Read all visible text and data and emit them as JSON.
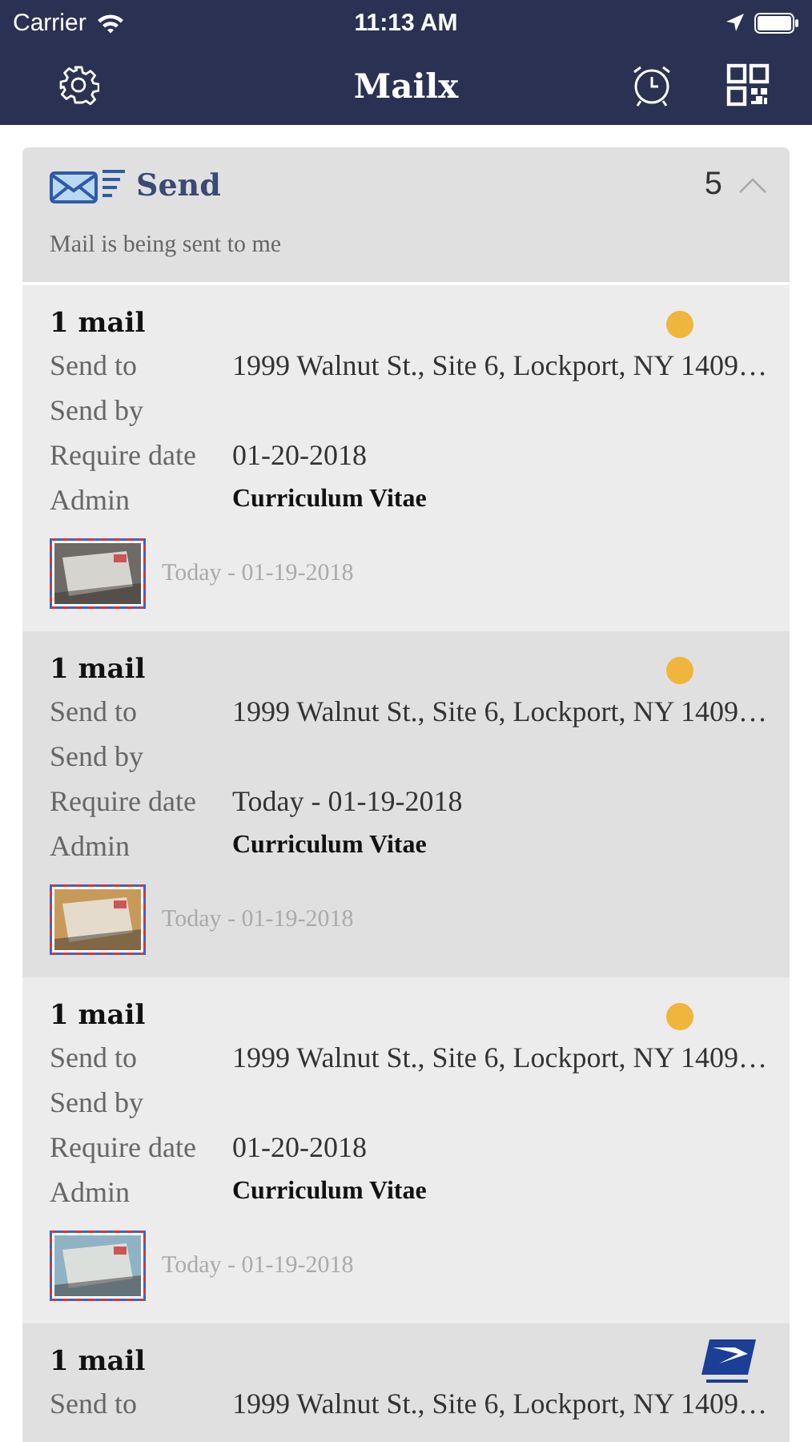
{
  "status_bar": {
    "carrier": "Carrier",
    "time": "11:13 AM"
  },
  "nav_bar": {
    "title": "Mailx"
  },
  "section": {
    "title": "Send",
    "count": "5",
    "expanded": true,
    "subtitle": "Mail is being sent to me"
  },
  "cards": [
    {
      "title": "1 mail",
      "marker": {
        "kind": "dot",
        "color": "#f0b53c"
      },
      "fields": [
        {
          "label": "Send to",
          "value": "1999 Walnut St., Site 6, Lockport, NY 1409…",
          "kind": "plain"
        },
        {
          "label": "Send by"
        },
        {
          "label": "Require date",
          "value": "01-20-2018",
          "kind": "plain"
        },
        {
          "label": "Admin",
          "value": "Curriculum Vitae",
          "kind": "strong"
        }
      ],
      "date": "Today - 01-19-2018"
    },
    {
      "title": "1 mail",
      "marker": {
        "kind": "dot",
        "color": "#f0b53c"
      },
      "fields": [
        {
          "label": "Send to",
          "value": "1999 Walnut St., Site 6, Lockport, NY 1409…",
          "kind": "plain"
        },
        {
          "label": "Send by"
        },
        {
          "label": "Require date",
          "value": "Today - 01-19-2018",
          "kind": "plain"
        },
        {
          "label": "Admin",
          "value": "Curriculum Vitae",
          "kind": "strong"
        }
      ],
      "date": "Today - 01-19-2018"
    },
    {
      "title": "1 mail",
      "marker": {
        "kind": "dot",
        "color": "#f0b53c"
      },
      "fields": [
        {
          "label": "Send to",
          "value": "1999 Walnut St., Site 6, Lockport, NY 1409…",
          "kind": "plain"
        },
        {
          "label": "Send by"
        },
        {
          "label": "Require date",
          "value": "01-20-2018",
          "kind": "plain"
        },
        {
          "label": "Admin",
          "value": "Curriculum Vitae",
          "kind": "strong"
        }
      ],
      "date": "Today - 01-19-2018"
    },
    {
      "title": "1 mail",
      "marker": {
        "kind": "emblem"
      },
      "fields": [
        {
          "label": "Send to",
          "value": "1999 Walnut St., Site 6, Lockport, NY 1409…",
          "kind": "plain"
        }
      ]
    }
  ]
}
